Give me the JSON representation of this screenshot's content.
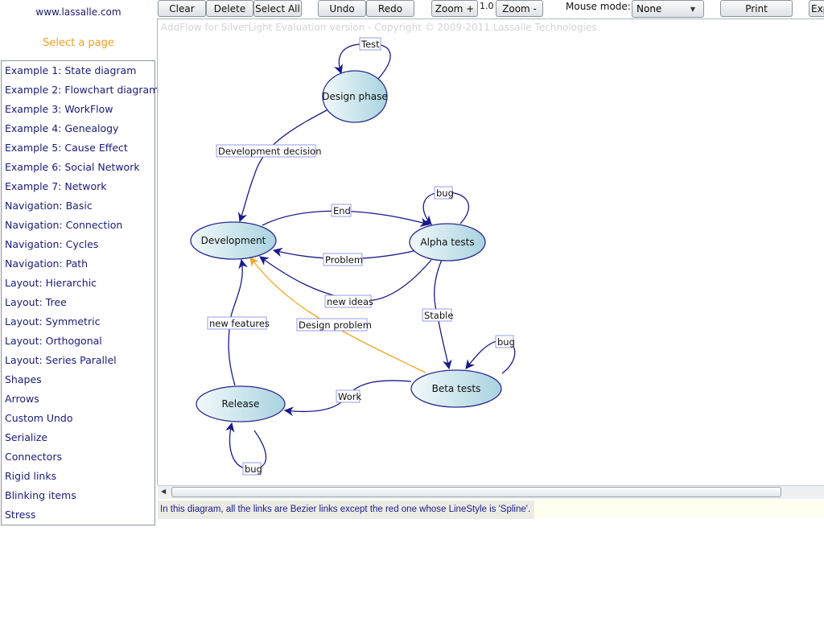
{
  "header": {
    "site_link": "www.lassalle.com",
    "select_page": "Select a page"
  },
  "sidebar": {
    "items": [
      {
        "label": "Example 1: State diagram"
      },
      {
        "label": "Example 2: Flowchart diagram"
      },
      {
        "label": "Example 3: WorkFlow"
      },
      {
        "label": "Example 4: Genealogy"
      },
      {
        "label": "Example 5: Cause Effect"
      },
      {
        "label": "Example 6: Social Network"
      },
      {
        "label": "Example 7: Network"
      },
      {
        "label": "Navigation: Basic"
      },
      {
        "label": "Navigation: Connection"
      },
      {
        "label": "Navigation: Cycles"
      },
      {
        "label": "Navigation: Path"
      },
      {
        "label": "Layout: Hierarchic"
      },
      {
        "label": "Layout: Tree"
      },
      {
        "label": "Layout: Symmetric"
      },
      {
        "label": "Layout: Orthogonal"
      },
      {
        "label": "Layout: Series Parallel"
      },
      {
        "label": "Shapes"
      },
      {
        "label": "Arrows"
      },
      {
        "label": "Custom Undo"
      },
      {
        "label": "Serialize"
      },
      {
        "label": "Connectors"
      },
      {
        "label": "Rigid links"
      },
      {
        "label": "Blinking items"
      },
      {
        "label": "Stress"
      }
    ]
  },
  "toolbar": {
    "clear": "Clear",
    "delete": "Delete",
    "select_all": "Select All",
    "undo": "Undo",
    "redo": "Redo",
    "zoom_in": "Zoom +",
    "zoom_value": "1.0",
    "zoom_out": "Zoom -",
    "mouse_mode_label": "Mouse mode:",
    "mouse_mode_value": "None",
    "print": "Print",
    "export": "Exp"
  },
  "canvas": {
    "watermark": "AddFlow for SilverLight Evaluation version - Copyright © 2009-2011 Lassalle Technologies"
  },
  "diagram": {
    "colors": {
      "link": "#1a1a8c",
      "highlight_link": "#f5a623",
      "node_stroke": "#2a2a90",
      "node_fill_light": "#eef7fa",
      "node_fill_dark": "#a9d3e0"
    },
    "nodes": [
      {
        "id": "design",
        "label": "Design phase"
      },
      {
        "id": "dev",
        "label": "Development"
      },
      {
        "id": "alpha",
        "label": "Alpha tests"
      },
      {
        "id": "beta",
        "label": "Beta tests"
      },
      {
        "id": "release",
        "label": "Release"
      }
    ],
    "links": [
      {
        "id": "test",
        "label": "Test"
      },
      {
        "id": "devdecision",
        "label": "Development decision"
      },
      {
        "id": "end",
        "label": "End"
      },
      {
        "id": "alphabug",
        "label": "bug"
      },
      {
        "id": "problem",
        "label": "Problem"
      },
      {
        "id": "newideas",
        "label": "new ideas"
      },
      {
        "id": "stable",
        "label": "Stable"
      },
      {
        "id": "designproblem",
        "label": "Design problem"
      },
      {
        "id": "betabug",
        "label": "bug"
      },
      {
        "id": "work",
        "label": "Work"
      },
      {
        "id": "newfeatures",
        "label": "new features"
      },
      {
        "id": "releasebug",
        "label": "bug"
      }
    ]
  },
  "status": {
    "text": "In this diagram, all the links are Bezier links except the red one whose LineStyle is 'Spline'."
  }
}
